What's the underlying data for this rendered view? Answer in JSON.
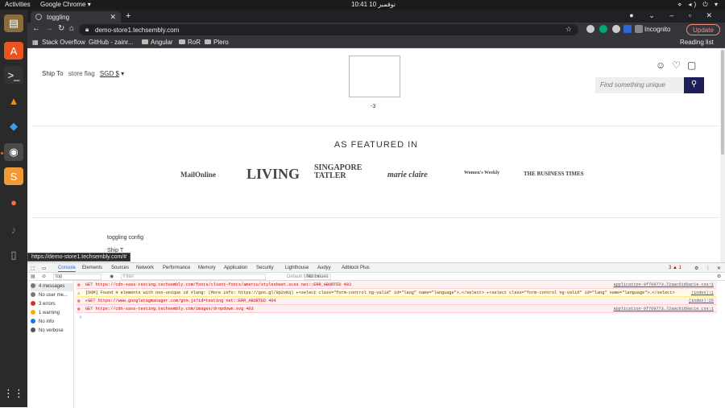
{
  "os": {
    "activities": "Activities",
    "app_name": "Google Chrome ▾",
    "clock": "نوفمبر 10  10:41",
    "tray": "⋄ ◂) ⏻ ▾"
  },
  "dock": [
    "files",
    "ubuntu-software",
    "terminal",
    "vlc",
    "vscode",
    "chrome",
    "sublime",
    "firefox",
    "guitar",
    "usb-drive",
    "app-grid"
  ],
  "browser": {
    "tab_title": "toggling",
    "url": "demo-store1.techsembly.com",
    "incognito": "Incognito",
    "update": "Update",
    "bookmarks": [
      "Stack Overflow",
      "GitHub - zainr...",
      "Angular",
      "RoR",
      "Plero"
    ],
    "reading_list": "Reading list"
  },
  "page": {
    "ship_to": "Ship To",
    "store_flag_alt": "store flag",
    "currency": "SGD $",
    "logo_caption": "-3",
    "search_placeholder": "Find something unique",
    "featured_heading": "AS FEATURED IN",
    "press_logos": [
      "MailOnline",
      "LIVING",
      "SINGAPORE TATLER",
      "marie claire",
      "Women's Weekly",
      "THE BUSINESS TIMES"
    ],
    "config_text": "toggling config",
    "config_text2": "Ship T",
    "status_url": "https://demo-store1.techsembly.com/#"
  },
  "devtools": {
    "tabs": [
      "Console",
      "Elements",
      "Sources",
      "Network",
      "Performance",
      "Memory",
      "Application",
      "Security",
      "Lighthouse",
      "Audyy",
      "Adblock Plus"
    ],
    "badges": "3 ▲ 1",
    "context": "top",
    "filter_placeholder": "Filter",
    "levels": "Default levels ▾",
    "issues": "No Issues",
    "sidebar": [
      {
        "label": "4 messages",
        "color": "#555"
      },
      {
        "label": "No user me...",
        "color": "#555"
      },
      {
        "label": "3 errors",
        "color": "#d93025"
      },
      {
        "label": "1 warning",
        "color": "#f9ab00"
      },
      {
        "label": "No info",
        "color": "#1a73e8"
      },
      {
        "label": "No verbose",
        "color": "#555"
      }
    ],
    "logs": [
      {
        "type": "err",
        "text": "GET https://cdn-sass-testing.techsembly.com/fonts/client-fonts/amercu/stylesheet.scss net::ERR_ABORTED 403",
        "src": "application-0f769773…72aac01d0ac1e.css:1"
      },
      {
        "type": "warn",
        "text": "[DOM] Found 4 elements with non-unique id #lang: (More info: https://goo.gl/9p2vKq) ▸<select class=\"form-control ng-valid\" id=\"lang\" name=\"language\">…</select> ▸<select class=\"form-control ng-valid\" id=\"lang\" name=\"language\">…</select>",
        "src": "(index):1"
      },
      {
        "type": "err",
        "text": "▸GET https://www.googletagmanager.com/gtm.js?id=testing net::ERR_ABORTED 404",
        "src": "(index):25"
      },
      {
        "type": "err",
        "text": "GET https://cdn-sass-testing.techsembly.com/images/dropdown.svg 403",
        "src": "application-0f769773…72aac01d0ac1e.css:1"
      }
    ]
  }
}
